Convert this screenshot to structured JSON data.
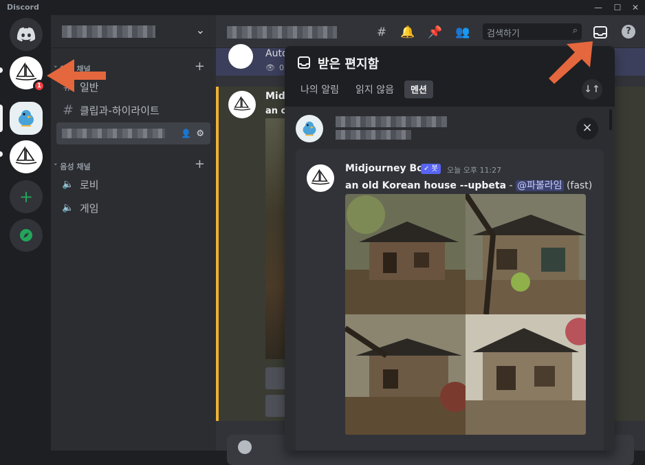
{
  "app": {
    "name": "Discord"
  },
  "window_controls": {
    "minimize": "—",
    "maximize": "☐",
    "close": "✕"
  },
  "server_rail": {
    "badge_count": "1"
  },
  "channel_sidebar": {
    "text_category": "채팅 채널",
    "channels": [
      {
        "symbol": "#",
        "name": "일반"
      },
      {
        "symbol": "#",
        "name": "클립과-하이라이트"
      }
    ],
    "voice_category": "음성 채널",
    "voice_channels": [
      {
        "symbol": "🔊",
        "name": "로비"
      },
      {
        "symbol": "🔊",
        "name": "게임"
      }
    ]
  },
  "topbar": {
    "search_placeholder": "검색하기"
  },
  "background_message": {
    "auto_label": "Auto",
    "author_partial": "Midj",
    "content_partial": "an o",
    "view_count_partial": "0"
  },
  "inbox": {
    "title": "받은 편지함",
    "tabs": [
      {
        "label": "나의 알림",
        "selected": false
      },
      {
        "label": "읽지 않음",
        "selected": false
      },
      {
        "label": "멘션",
        "selected": true
      }
    ],
    "sort_label": "↓↑",
    "message": {
      "author": "Midjourney Bot",
      "bot_badge": "✓ 봇",
      "timestamp": "오늘 오후 11:27",
      "prompt": "an old Korean house --upbeta",
      "separator": " - ",
      "mention": "@파볼라임",
      "suffix": " (fast)"
    }
  },
  "colors": {
    "accent_arrow": "#e5673d",
    "mention_bg": "#3c4270",
    "bot_badge": "#5865f2",
    "unread_badge": "#f23f43"
  }
}
